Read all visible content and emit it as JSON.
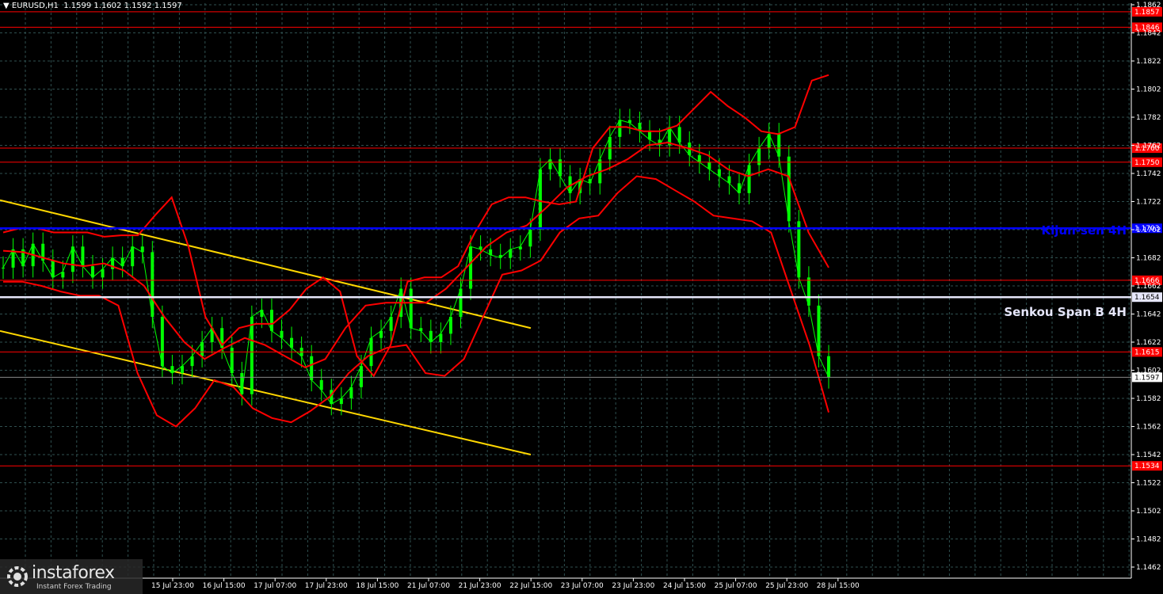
{
  "header": {
    "symbol": "EURUSD,H1",
    "ohlc": "1.1599 1.1602 1.1592 1.1597"
  },
  "logo": {
    "name": "instaforex",
    "tagline": "Instant Forex Trading"
  },
  "colors": {
    "background": "#000000",
    "candle": "#00ff00",
    "grid": "#2f4f4f",
    "level_line": "#ff0000",
    "bollinger": "#ff0000",
    "kijun": "#0000ff",
    "senkou": "#e6e6fa",
    "channel": "#ffd700"
  },
  "chart_data": {
    "type": "line",
    "title": "",
    "xlabel": "",
    "ylabel": "",
    "ylim": [
      1.1452,
      1.1866
    ],
    "yticks": [
      "1.1862",
      "1.1842",
      "1.1822",
      "1.1802",
      "1.1782",
      "1.1762",
      "1.1742",
      "1.1722",
      "1.1702",
      "1.1682",
      "1.1662",
      "1.1642",
      "1.1622",
      "1.1602",
      "1.1582",
      "1.1562",
      "1.1542",
      "1.1522",
      "1.1502",
      "1.1482",
      "1.1462"
    ],
    "xticks": [
      "15 Jul 23:00",
      "16 Jul 15:00",
      "17 Jul 07:00",
      "17 Jul 23:00",
      "18 Jul 15:00",
      "21 Jul 07:00",
      "21 Jul 23:00",
      "22 Jul 15:00",
      "23 Jul 07:00",
      "23 Jul 23:00",
      "24 Jul 15:00",
      "25 Jul 07:00",
      "25 Jul 23:00",
      "28 Jul 15:00"
    ],
    "levels": [
      {
        "value": 1.1857,
        "label": "1.1857",
        "color": "#ff0000"
      },
      {
        "value": 1.1846,
        "label": "1.1846",
        "color": "#ff0000"
      },
      {
        "value": 1.176,
        "label": "1.1760",
        "color": "#ff0000"
      },
      {
        "value": 1.175,
        "label": "1.1750",
        "color": "#ff0000"
      },
      {
        "value": 1.1703,
        "label": "1.1703",
        "color": "#0000ff",
        "name": "Kijun-sen 4H"
      },
      {
        "value": 1.1666,
        "label": "1.1666",
        "color": "#ff0000"
      },
      {
        "value": 1.1654,
        "label": "1.1654",
        "color": "#e6e6fa",
        "name": "Senkou Span B 4H"
      },
      {
        "value": 1.1615,
        "label": "1.1615",
        "color": "#ff0000"
      },
      {
        "value": 1.1534,
        "label": "1.1534",
        "color": "#ff0000"
      }
    ],
    "current_price": {
      "value": 1.1597,
      "label": "1.1597"
    },
    "price": {
      "name": "",
      "values": [
        1.1675,
        1.1688,
        1.1676,
        1.1692,
        1.168,
        1.1668,
        1.1672,
        1.169,
        1.1676,
        1.1668,
        1.1674,
        1.1682,
        1.1676,
        1.169,
        1.1686,
        1.164,
        1.1605,
        1.16,
        1.1605,
        1.1612,
        1.1622,
        1.1632,
        1.1618,
        1.16,
        1.1585,
        1.164,
        1.1645,
        1.163,
        1.1625,
        1.1618,
        1.1612,
        1.1595,
        1.1588,
        1.1578,
        1.1582,
        1.159,
        1.1605,
        1.1625,
        1.163,
        1.164,
        1.166,
        1.1632,
        1.163,
        1.1622,
        1.1628,
        1.164,
        1.166,
        1.169,
        1.1688,
        1.1684,
        1.1682,
        1.1688,
        1.169,
        1.1702,
        1.1745,
        1.1752,
        1.174,
        1.1728,
        1.1738,
        1.1735,
        1.1752,
        1.1768,
        1.178,
        1.1778,
        1.1772,
        1.1766,
        1.1762,
        1.1775,
        1.1764,
        1.1755,
        1.175,
        1.1745,
        1.174,
        1.1735,
        1.1728,
        1.1748,
        1.176,
        1.177,
        1.1754,
        1.1708,
        1.1668,
        1.1648,
        1.1612,
        1.1597
      ]
    },
    "bollinger_upper": {
      "name": "",
      "values": [
        1.17,
        1.1703,
        1.1703,
        1.17,
        1.17,
        1.17,
        1.1697,
        1.1698,
        1.1698,
        1.1712,
        1.1725,
        1.169,
        1.164,
        1.162,
        1.1632,
        1.1635,
        1.1635,
        1.1645,
        1.166,
        1.1668,
        1.1658,
        1.1612,
        1.1598,
        1.162,
        1.1665,
        1.1668,
        1.1668,
        1.1676,
        1.17,
        1.172,
        1.1725,
        1.1725,
        1.1722,
        1.172,
        1.1722,
        1.176,
        1.1775,
        1.1775,
        1.1772,
        1.1772,
        1.1776,
        1.1788,
        1.18,
        1.179,
        1.1782,
        1.1772,
        1.177,
        1.1775,
        1.1808,
        1.1812
      ]
    },
    "bollinger_middle": {
      "name": "",
      "values": [
        1.1687,
        1.1686,
        1.1682,
        1.1678,
        1.1676,
        1.1678,
        1.1673,
        1.1662,
        1.164,
        1.1622,
        1.161,
        1.1618,
        1.1625,
        1.162,
        1.1612,
        1.1604,
        1.161,
        1.1632,
        1.1648,
        1.165,
        1.165,
        1.165,
        1.166,
        1.1675,
        1.169,
        1.17,
        1.1705,
        1.1718,
        1.1732,
        1.174,
        1.1745,
        1.1752,
        1.1762,
        1.1764,
        1.176,
        1.1755,
        1.1745,
        1.174,
        1.1745,
        1.174,
        1.17,
        1.1675
      ]
    },
    "bollinger_lower": {
      "name": "",
      "values": [
        1.1665,
        1.1665,
        1.1662,
        1.1658,
        1.1655,
        1.1655,
        1.1648,
        1.16,
        1.157,
        1.1562,
        1.1575,
        1.1595,
        1.159,
        1.1575,
        1.1568,
        1.1565,
        1.1573,
        1.1583,
        1.16,
        1.1612,
        1.1618,
        1.162,
        1.16,
        1.1598,
        1.161,
        1.164,
        1.167,
        1.1673,
        1.168,
        1.17,
        1.171,
        1.1712,
        1.1728,
        1.174,
        1.1738,
        1.173,
        1.1722,
        1.1712,
        1.171,
        1.1708,
        1.17,
        1.166,
        1.162,
        1.1572
      ]
    },
    "channel_upper": {
      "x": [
        0,
        670
      ],
      "y": [
        1.1723,
        1.1632
      ]
    },
    "channel_lower": {
      "x": [
        0,
        670
      ],
      "y": [
        1.163,
        1.1542
      ]
    }
  }
}
